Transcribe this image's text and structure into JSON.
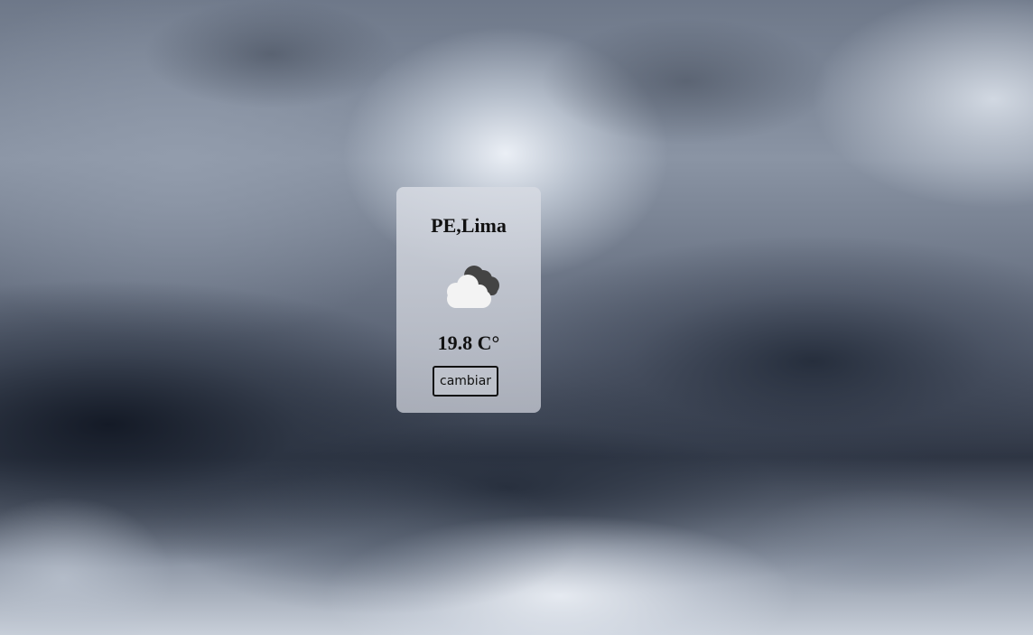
{
  "weather": {
    "location": "PE,Lima",
    "temperature": "19.8 C°",
    "icon": "cloudy-icon",
    "change_label": "cambiar"
  },
  "colors": {
    "card_background": "#c8ccd4",
    "text": "#111111",
    "cloud_light": "#f3f3f3",
    "cloud_dark": "#444444"
  }
}
